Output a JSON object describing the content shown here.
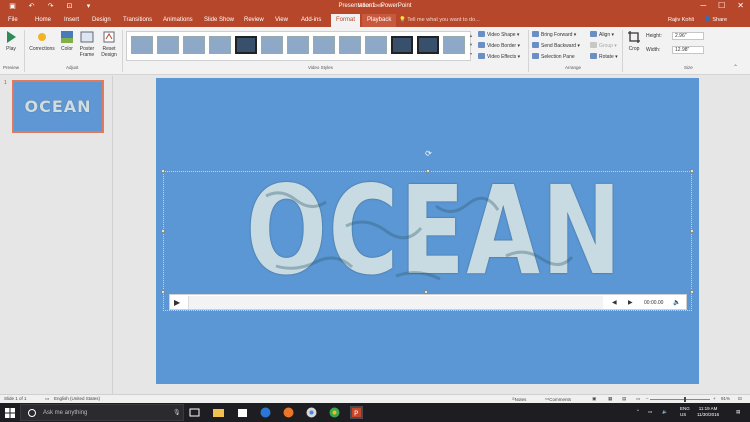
{
  "window": {
    "title": "Presentation1 - PowerPoint",
    "context_title": "Video Tools",
    "controls": [
      "─",
      "☐",
      "✕"
    ]
  },
  "tabs": [
    {
      "label": "File"
    },
    {
      "label": "Home"
    },
    {
      "label": "Insert"
    },
    {
      "label": "Design"
    },
    {
      "label": "Transitions"
    },
    {
      "label": "Animations"
    },
    {
      "label": "Slide Show"
    },
    {
      "label": "Review"
    },
    {
      "label": "View"
    },
    {
      "label": "Add-ins"
    },
    {
      "label": "Format"
    },
    {
      "label": "Playback"
    }
  ],
  "tell_me": "Tell me what you want to do...",
  "user": "Rajiv Kohli",
  "share_label": "Share",
  "ribbon": {
    "preview": {
      "play": "Play",
      "group": "Preview"
    },
    "adjust": {
      "corrections": "Corrections",
      "color": "Color",
      "poster": "Poster Frame",
      "reset": "Reset Design",
      "group": "Adjust"
    },
    "video_styles": {
      "group": "Video Styles",
      "shape": "Video Shape",
      "border": "Video Border",
      "effects": "Video Effects"
    },
    "arrange": {
      "group": "Arrange",
      "bring_forward": "Bring Forward",
      "send_backward": "Send Backward",
      "selection_pane": "Selection Pane",
      "align": "Align",
      "group_cmd": "Group",
      "rotate": "Rotate"
    },
    "size": {
      "group": "Size",
      "crop": "Crop",
      "height_label": "Height:",
      "height_value": "2.96\"",
      "width_label": "Width:",
      "width_value": "12.98\""
    }
  },
  "slide_panel": {
    "number": "1",
    "thumb_text": "OCEAN"
  },
  "slide": {
    "text": "OCEAN",
    "background": "#5b97d5"
  },
  "player": {
    "time": "00:00.00"
  },
  "status": {
    "slide_info": "Slide 1 of 1",
    "language": "English (United States)",
    "notes": "Notes",
    "comments": "Comments",
    "zoom": "91%"
  },
  "taskbar": {
    "search_placeholder": "Ask me anything",
    "lang": "ENG",
    "region": "US",
    "time": "11:19 AM",
    "date": "11/30/2016"
  }
}
